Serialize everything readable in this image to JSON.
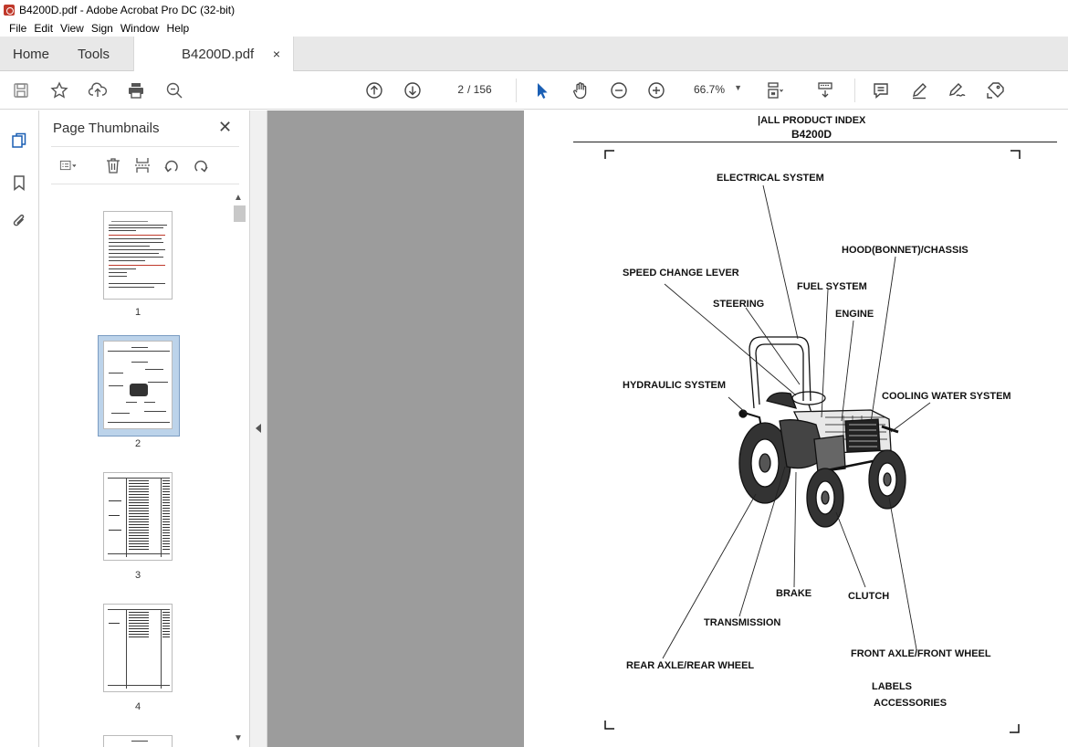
{
  "window": {
    "title": "B4200D.pdf - Adobe Acrobat Pro DC (32-bit)"
  },
  "menu": [
    "File",
    "Edit",
    "View",
    "Sign",
    "Window",
    "Help"
  ],
  "tabs": {
    "home": "Home",
    "tools": "Tools",
    "document": "B4200D.pdf",
    "close": "×"
  },
  "toolbar": {
    "current_page": "2",
    "page_total": "/ 156",
    "zoom": "66.7%"
  },
  "thumbnails": {
    "panel_title": "Page Thumbnails",
    "close": "✕",
    "pages": [
      "1",
      "2",
      "3",
      "4"
    ]
  },
  "document": {
    "header_title": "|ALL PRODUCT INDEX",
    "header_model": "B4200D",
    "labels": {
      "electrical": "ELECTRICAL SYSTEM",
      "hood": "HOOD(BONNET)/CHASSIS",
      "speed_lever": "SPEED CHANGE LEVER",
      "fuel": "FUEL SYSTEM",
      "steering": "STEERING",
      "engine": "ENGINE",
      "hydraulic": "HYDRAULIC SYSTEM",
      "cooling": "COOLING WATER SYSTEM",
      "brake": "BRAKE",
      "clutch": "CLUTCH",
      "transmission": "TRANSMISSION",
      "front_axle": "FRONT AXLE/FRONT WHEEL",
      "rear_axle": "REAR AXLE/REAR WHEEL",
      "labels_item": "LABELS",
      "accessories": "ACCESSORIES"
    }
  }
}
